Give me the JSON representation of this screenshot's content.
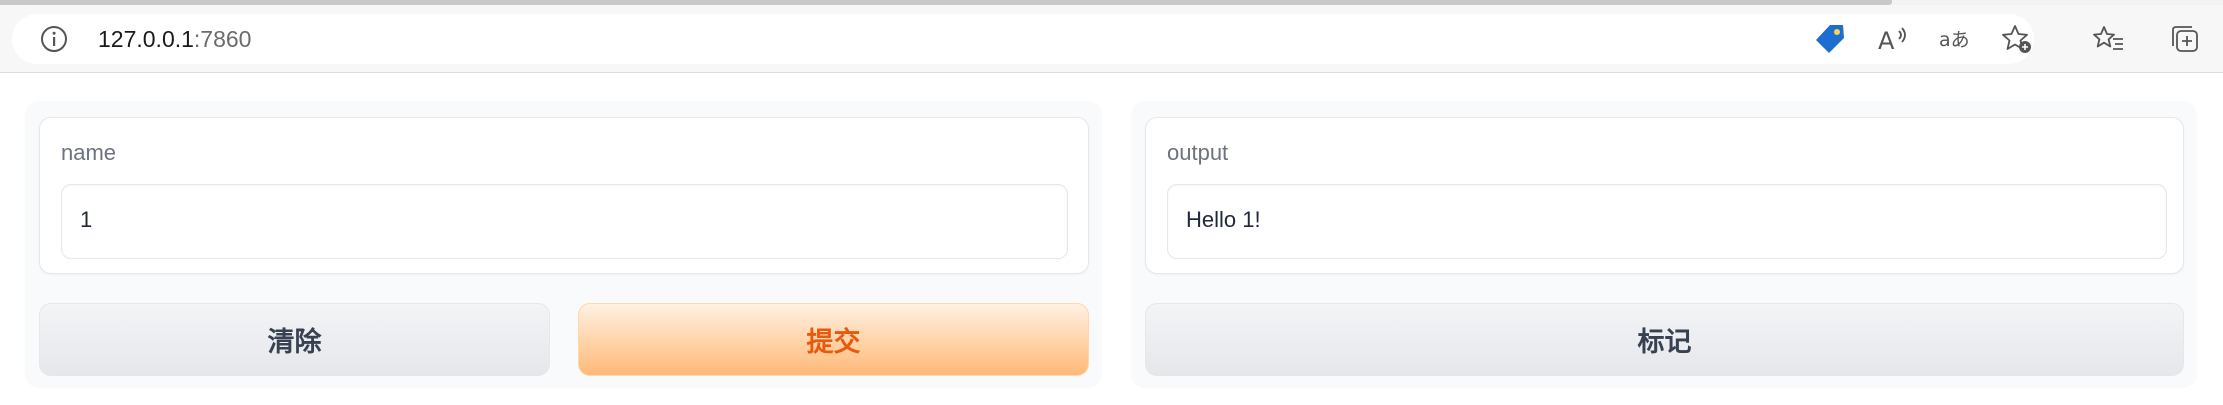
{
  "browser": {
    "url_host": "127.0.0.1",
    "url_port": ":7860",
    "icons": [
      "info-icon",
      "shopping-tag-icon",
      "read-aloud-icon",
      "translate-icon",
      "add-favorite-icon",
      "favorites-icon",
      "collections-icon"
    ]
  },
  "input_panel": {
    "label": "name",
    "value": "1",
    "clear_button": "清除",
    "submit_button": "提交"
  },
  "output_panel": {
    "label": "output",
    "value": "Hello 1!",
    "flag_button": "标记"
  },
  "colors": {
    "primary_text": "#ea580c",
    "primary_bg_from": "#fff1e3",
    "primary_bg_to": "#ffb977",
    "secondary_text": "#374151"
  }
}
